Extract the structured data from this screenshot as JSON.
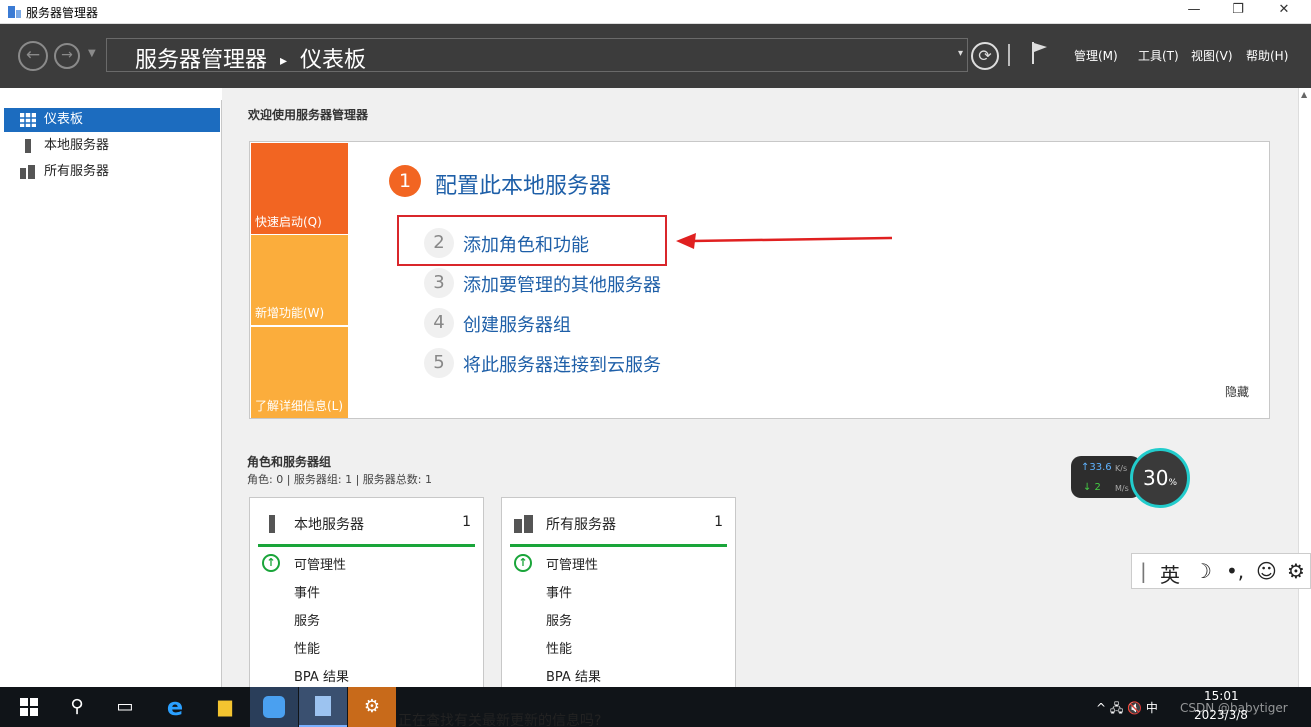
{
  "window": {
    "title": "服务器管理器",
    "minimize": "—",
    "maximize": "❐",
    "close": "✕"
  },
  "navbar": {
    "back": "←",
    "forward": "→",
    "breadcrumb_root": "服务器管理器",
    "breadcrumb_sep": "▸",
    "breadcrumb_current": "仪表板",
    "refresh": "⟳",
    "menus": [
      "管理(M)",
      "工具(T)",
      "视图(V)",
      "帮助(H)"
    ]
  },
  "sidebar": {
    "items": [
      {
        "label": "仪表板",
        "icon": "dashboard-icon",
        "active": true
      },
      {
        "label": "本地服务器",
        "icon": "server-icon",
        "active": false
      },
      {
        "label": "所有服务器",
        "icon": "servers-icon",
        "active": false
      }
    ]
  },
  "welcome": {
    "heading": "欢迎使用服务器管理器",
    "tiles": [
      {
        "label": "快速启动(Q)",
        "color": "#f26522"
      },
      {
        "label": "新增功能(W)",
        "color": "#fbad3c"
      },
      {
        "label": "了解详细信息(L)",
        "color": "#fbad3c"
      }
    ],
    "main_step": {
      "num": "1",
      "label": "配置此本地服务器"
    },
    "steps": [
      {
        "num": "2",
        "label": "添加角色和功能"
      },
      {
        "num": "3",
        "label": "添加要管理的其他服务器"
      },
      {
        "num": "4",
        "label": "创建服务器组"
      },
      {
        "num": "5",
        "label": "将此服务器连接到云服务"
      }
    ],
    "hide": "隐藏"
  },
  "roles": {
    "title": "角色和服务器组",
    "subtitle": "角色: 0 | 服务器组: 1 | 服务器总数: 1",
    "cards": [
      {
        "title": "本地服务器",
        "count": "1",
        "rows": [
          "可管理性",
          "事件",
          "服务",
          "性能",
          "BPA 结果"
        ]
      },
      {
        "title": "所有服务器",
        "count": "1",
        "rows": [
          "可管理性",
          "事件",
          "服务",
          "性能",
          "BPA 结果"
        ]
      }
    ]
  },
  "overlay": {
    "up_speed": "↑33.6",
    "up_unit": "K/s",
    "down_speed": "↓ 2",
    "down_unit": "M/s",
    "percent": "30",
    "percent_unit": "%",
    "ime": [
      "|",
      "英",
      "☽",
      "•,",
      "☺",
      "⚙"
    ]
  },
  "taskbar": {
    "icons": [
      "windows-icon",
      "search-icon",
      "task-view-icon",
      "ie-icon",
      "file-explorer-icon",
      "app-icon",
      "server-manager-icon",
      "settings-icon"
    ],
    "ghost_text": "正在查找有关最新更新的信息吗?",
    "tray": "^  🖧  🔇  中",
    "time": "15:01",
    "date": "2023/3/8",
    "watermark": "CSDN @babytiger"
  },
  "colors": {
    "accent": "#1c6cbf",
    "arrow": "#e02020",
    "highlight_box": "#d9262b",
    "green": "#1aa53a"
  }
}
